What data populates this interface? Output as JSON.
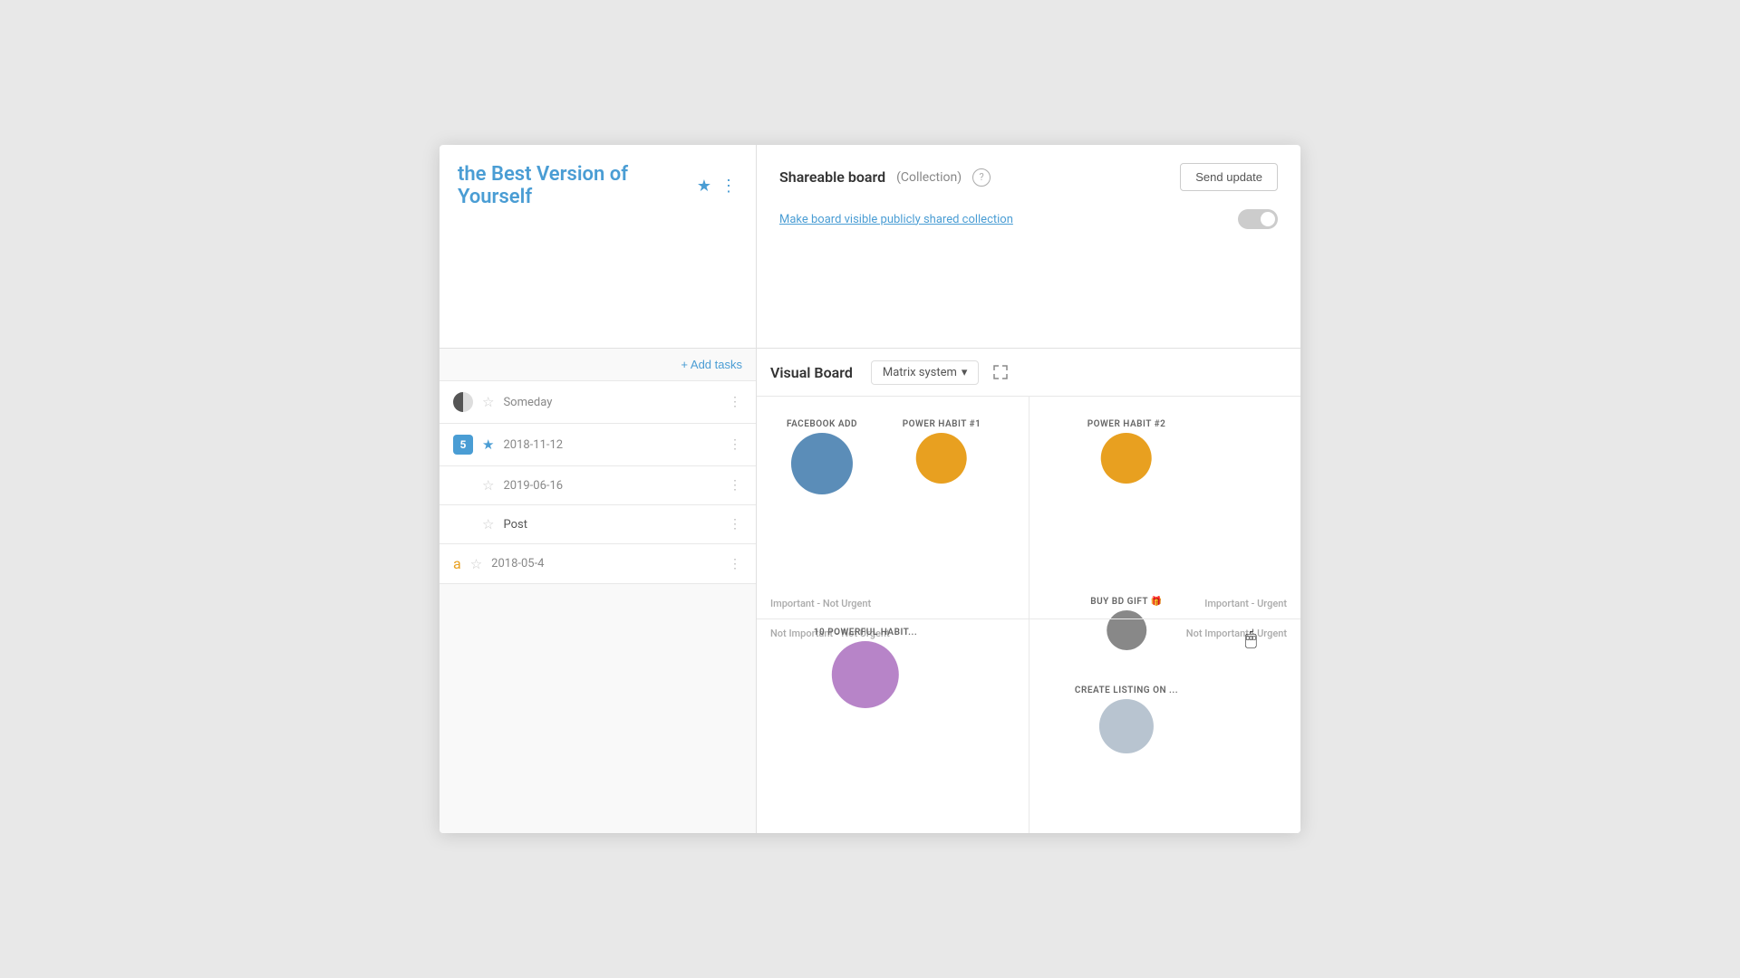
{
  "app": {
    "title": "the Best Version of Yourself"
  },
  "topLeft": {
    "boardTitle": "the Best Version of Yourself",
    "starIcon": "★",
    "dotsIcon": "⋮"
  },
  "topRight": {
    "shareableTitle": "Shareable board",
    "collectionLabel": "(Collection)",
    "helpIcon": "?",
    "sendUpdateLabel": "Send update",
    "makeVisibleText": "Make board visible publicly shared collection",
    "toggleState": "off"
  },
  "bottomLeft": {
    "addTasksLabel": "+ Add tasks",
    "tasks": [
      {
        "id": 1,
        "iconType": "half-circle",
        "starActive": false,
        "starColor": "blue",
        "date": "Someday",
        "hasDate": false
      },
      {
        "id": 2,
        "iconType": "badge",
        "badgeText": "5",
        "starActive": true,
        "starColor": "blue",
        "date": "2018-11-12",
        "hasDate": true
      },
      {
        "id": 3,
        "iconType": "none",
        "starActive": false,
        "starColor": "none",
        "date": "2019-06-16",
        "hasDate": true
      },
      {
        "id": 4,
        "iconType": "none",
        "starActive": false,
        "starColor": "none",
        "date": "Post",
        "hasDate": false
      },
      {
        "id": 5,
        "iconType": "amazon",
        "starActive": false,
        "starColor": "none",
        "date": "2018-05-4",
        "hasDate": true
      }
    ]
  },
  "bottomRight": {
    "title": "Visual Board",
    "dropdownLabel": "Matrix system",
    "quadrants": {
      "topLeft": "Important - Not Urgent",
      "topRight": "Important - Urgent",
      "bottomLeft": "Not Important - Not Urgent",
      "bottomRight": "Not Important - Urgent"
    },
    "bubbles": [
      {
        "id": "facebook-add",
        "label": "FACEBOOK ADD",
        "color": "#5b8db8",
        "size": 70,
        "x": 15,
        "y": 8,
        "quadrant": "top-left"
      },
      {
        "id": "power-habit-1",
        "label": "POWER HABIT #1",
        "color": "#e8a020",
        "size": 58,
        "x": 35,
        "y": 8,
        "quadrant": "top-left"
      },
      {
        "id": "power-habit-2",
        "label": "POWER HABIT #2",
        "color": "#e8a020",
        "size": 58,
        "x": 65,
        "y": 8,
        "quadrant": "top-right"
      },
      {
        "id": "10-powerful-habit",
        "label": "10 POWERFUL HABIT...",
        "color": "#b784c8",
        "size": 75,
        "x": 22,
        "y": 58,
        "quadrant": "bottom-left"
      },
      {
        "id": "buy-bd-gift",
        "label": "BUY BD GIFT 🎁",
        "color": "#888",
        "size": 45,
        "x": 68,
        "y": 52,
        "quadrant": "bottom-right"
      },
      {
        "id": "create-listing",
        "label": "CREATE LISTING ON ...",
        "color": "#b8c4d0",
        "size": 60,
        "x": 68,
        "y": 72,
        "quadrant": "bottom-right"
      }
    ]
  }
}
